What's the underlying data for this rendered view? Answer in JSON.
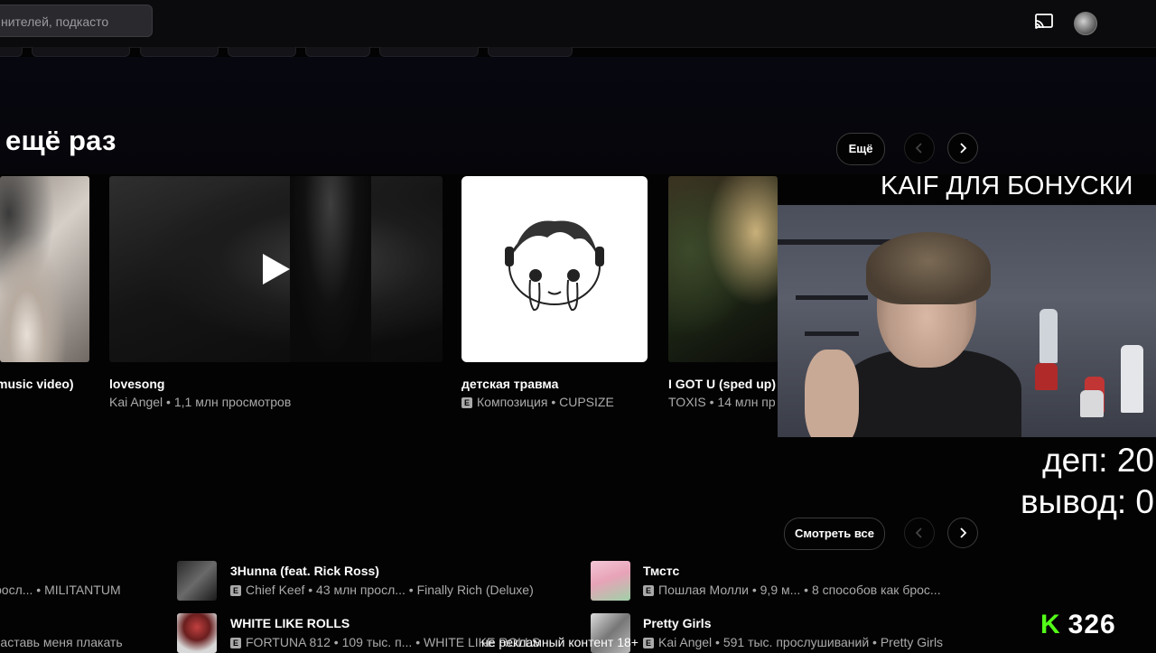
{
  "search": {
    "placeholder": "нителей, подкасто"
  },
  "section": {
    "title": "ещё раз",
    "more_button": "Ещё"
  },
  "cards": [
    {
      "title": "music video)",
      "subtitle": ""
    },
    {
      "title": "lovesong",
      "subtitle": "Kai Angel • 1,1 млн просмотров"
    },
    {
      "title": "детская травма",
      "subtitle": "Композиция • CUPSIZE",
      "explicit": true
    },
    {
      "title": "I GOT U (sped up)",
      "subtitle": "TOXIS • 14 млн пр"
    }
  ],
  "stream": {
    "webcam_title": "KAIF ДЛЯ БОНУСКИ",
    "dep": "деп: 20",
    "withdraw": "вывод: 0",
    "viewers": "326",
    "caption": "не рекламный контент 18+"
  },
  "list_section": {
    "see_all_button": "Смотреть все"
  },
  "list": [
    {
      "title": "",
      "subtitle": "росл... • MILITANTUM"
    },
    {
      "title": "3Hunna (feat. Rick Ross)",
      "subtitle": "Chief Keef • 43 млн просл... • Finally Rich (Deluxe)",
      "explicit": true
    },
    {
      "title": "Тмстс",
      "subtitle": "Пошлая Молли • 9,9 м... • 8 способов как брос...",
      "explicit": true
    },
    {
      "title": "",
      "subtitle": "заставь меня плакать"
    },
    {
      "title": "WHITE LIKE ROLLS",
      "subtitle": "FORTUNA 812 • 109 тыс. п... • WHITE LIKE ROLLS",
      "explicit": true
    },
    {
      "title": "Pretty Girls",
      "subtitle": "Kai Angel • 591 тыс. прослушиваний • Pretty Girls",
      "explicit": true
    }
  ],
  "icons": {
    "cast": "cast-icon",
    "avatar": "avatar",
    "prev": "chevron-left-icon",
    "next": "chevron-right-icon",
    "play": "play-icon",
    "kick": "kick-logo"
  },
  "colors": {
    "kick_green": "#53fc18",
    "background": "#030303"
  }
}
